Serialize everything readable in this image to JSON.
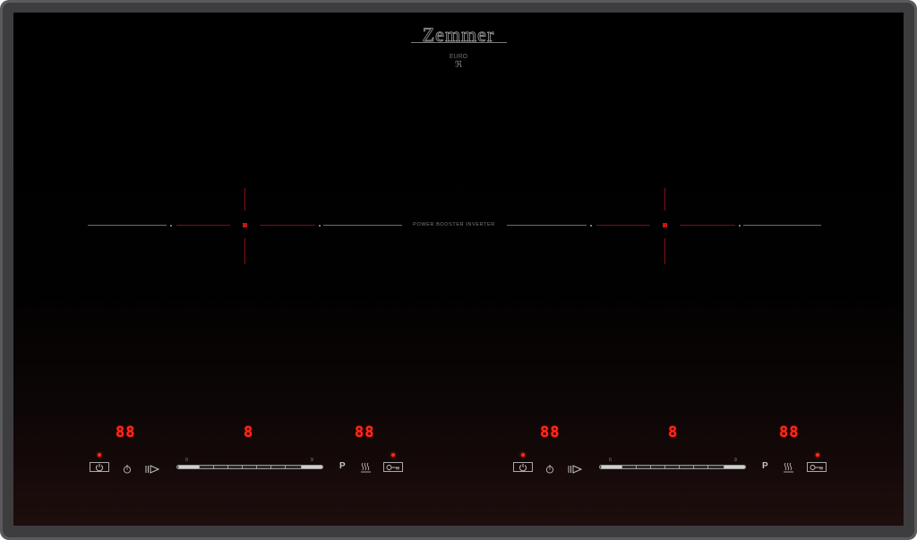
{
  "brand": {
    "name": "Zemmer",
    "sub": "EURO",
    "sub_mark": "ℜ"
  },
  "center_label": "POWER BOOSTER INVERTER",
  "colors": {
    "display_red": "#ff2b1c",
    "glass": "#000000",
    "frame": "#5a5a5c"
  },
  "panels": [
    {
      "timer_left": "88",
      "power_level": "8",
      "timer_right": "88",
      "slider": {
        "min_label": "0",
        "max_label": "9",
        "level": 0
      },
      "pause_label": "P",
      "icons": [
        "power-icon",
        "timer-icon",
        "booster-icon",
        "keep-warm-icon",
        "lock-icon"
      ]
    },
    {
      "timer_left": "88",
      "power_level": "8",
      "timer_right": "88",
      "slider": {
        "min_label": "0",
        "max_label": "9",
        "level": 0
      },
      "pause_label": "P",
      "icons": [
        "power-icon",
        "timer-icon",
        "booster-icon",
        "keep-warm-icon",
        "lock-icon"
      ]
    }
  ]
}
